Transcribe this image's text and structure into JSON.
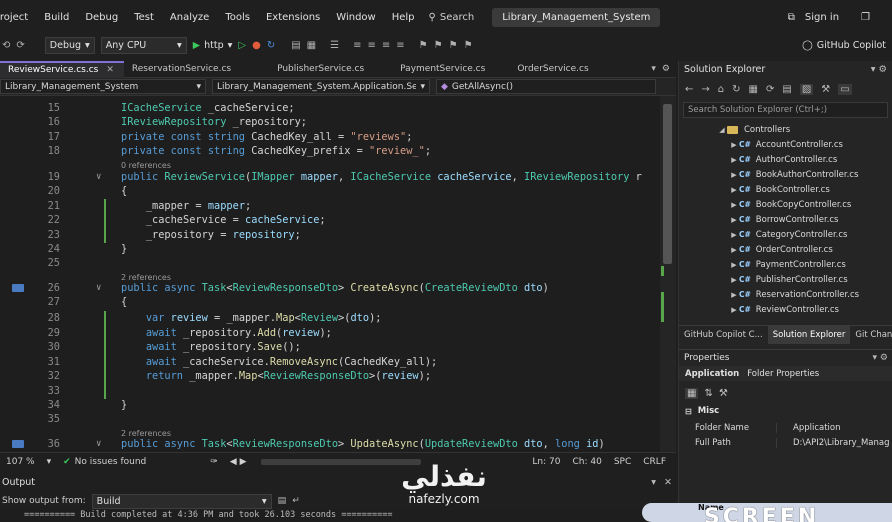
{
  "menu": {
    "items": [
      "Project",
      "Build",
      "Debug",
      "Test",
      "Analyze",
      "Tools",
      "Extensions",
      "Window",
      "Help"
    ],
    "search_label": "Search",
    "solution_title": "Library_Management_System",
    "signin": "Sign in"
  },
  "toolbar": {
    "config": "Debug",
    "platform": "Any CPU",
    "run_target": "http",
    "copilot": "GitHub Copilot"
  },
  "tabs": [
    {
      "label": "ReviewService.cs.cs",
      "active": true
    },
    {
      "label": "ReservationService.cs",
      "active": false
    },
    {
      "label": "PublisherService.cs",
      "active": false
    },
    {
      "label": "PaymentService.cs",
      "active": false
    },
    {
      "label": "OrderService.cs",
      "active": false
    }
  ],
  "navbar": {
    "project": "Library_Management_System",
    "scope": "Library_Management_System.Application.Sen",
    "member": "GetAllAsync()"
  },
  "code_lines": [
    {
      "n": "15",
      "text": "ICacheService _cacheService;"
    },
    {
      "n": "16",
      "text": "IReviewRepository _repository;"
    },
    {
      "n": "17",
      "text": "private const string CachedKey_all = \"reviews\";"
    },
    {
      "n": "18",
      "text": "private const string CachedKey_prefix = \"review_\";"
    },
    {
      "n": "19",
      "text": "public ReviewService(IMapper mapper, ICacheService cacheService, IReviewRepository r"
    },
    {
      "n": "20",
      "text": "{"
    },
    {
      "n": "21",
      "text": "    _mapper = mapper;"
    },
    {
      "n": "22",
      "text": "    _cacheService = cacheService;"
    },
    {
      "n": "23",
      "text": "    _repository = repository;"
    },
    {
      "n": "24",
      "text": "}"
    },
    {
      "n": "25",
      "text": ""
    },
    {
      "n": "26",
      "text": "public async Task<ReviewResponseDto> CreateAsync(CreateReviewDto dto)"
    },
    {
      "n": "27",
      "text": "{"
    },
    {
      "n": "28",
      "text": "    var review = _mapper.Map<Review>(dto);"
    },
    {
      "n": "29",
      "text": "    await _repository.Add(review);"
    },
    {
      "n": "30",
      "text": "    await _repository.Save();"
    },
    {
      "n": "31",
      "text": "    await _cacheService.RemoveAsync(CachedKey_all);"
    },
    {
      "n": "32",
      "text": "    return _mapper.Map<ReviewResponseDto>(review);"
    },
    {
      "n": "33",
      "text": ""
    },
    {
      "n": "34",
      "text": "}"
    },
    {
      "n": "35",
      "text": ""
    },
    {
      "n": "36",
      "text": "public async Task<ReviewResponseDto> UpdateAsync(UpdateReviewDto dto, long id)"
    }
  ],
  "codelens": {
    "zero_refs": "0 references",
    "two_refs": "2 references"
  },
  "status_line": {
    "zoom": "107 %",
    "issues": "No issues found",
    "ln": "Ln: 70",
    "ch": "Ch: 40",
    "spc": "SPC",
    "crlf": "CRLF"
  },
  "output": {
    "title": "Output",
    "show_from_label": "Show output from:",
    "source": "Build",
    "last_line": "========== Build completed at 4:36 PM and took 26.103 seconds =========="
  },
  "solution_explorer": {
    "title": "Solution Explorer",
    "search_placeholder": "Search Solution Explorer (Ctrl+;)",
    "folder": "Controllers",
    "files": [
      "AccountController.cs",
      "AuthorController.cs",
      "BookAuthorController.cs",
      "BookController.cs",
      "BookCopyController.cs",
      "BorrowController.cs",
      "CategoryController.cs",
      "OrderController.cs",
      "PaymentController.cs",
      "PublisherController.cs",
      "ReservationController.cs",
      "ReviewController.cs"
    ],
    "cs_glyph": "C#"
  },
  "panel_tabs": [
    "GitHub Copilot C...",
    "Solution Explorer",
    "Git Chan"
  ],
  "properties": {
    "title": "Properties",
    "subject": "Application",
    "subject_type": "Folder Properties",
    "category": "Misc",
    "rows": [
      {
        "key": "Folder Name",
        "value": "Application"
      },
      {
        "key": "Full Path",
        "value": "D:\\API2\\Library_Manag"
      }
    ]
  },
  "watermark": {
    "arabic": "نفذلي",
    "url": "nafezly.com",
    "recorder_name": "Name",
    "recorder_brand": "SCREEN"
  },
  "colors": {
    "background": "#1f1f1f",
    "editor": "#1e1e1e",
    "keyword": "#569cd6",
    "type": "#4ec9b0",
    "string": "#d69d85",
    "method": "#dcdcaa",
    "change_bar": "#57a64a",
    "tab_accent": "#7f6fd6"
  }
}
